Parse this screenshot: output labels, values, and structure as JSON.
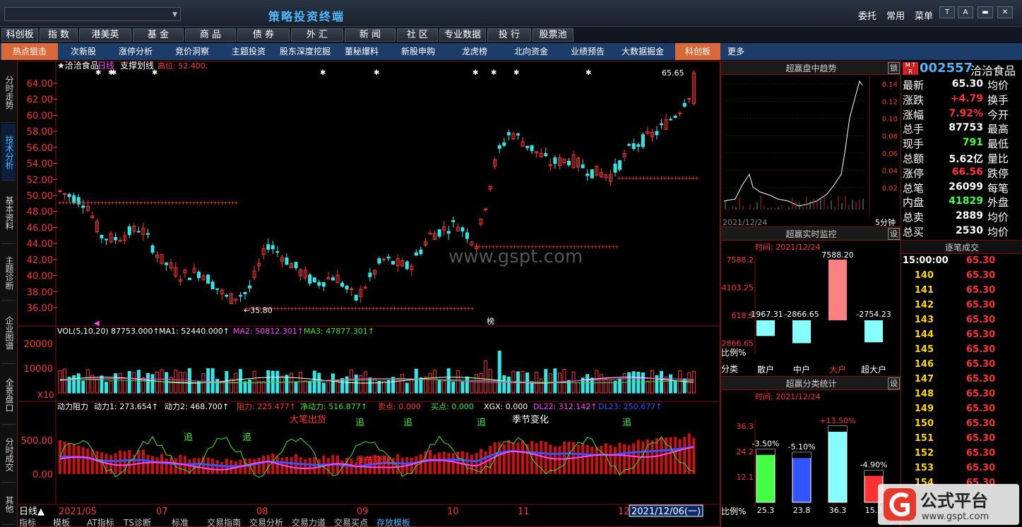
{
  "app": {
    "title": "策略投资终端",
    "menu": [
      "委托",
      "常用",
      "菜单"
    ],
    "window_buttons": [
      "T",
      "A",
      "▬",
      "✕"
    ]
  },
  "nav1": [
    "科创板",
    "指 数",
    "港美英",
    "基 金",
    "商 品",
    "债 券",
    "外 汇",
    "新 闻",
    "社 区",
    "专业数据",
    "投 行",
    "股票池"
  ],
  "nav2": [
    "热点狙击",
    "次新股",
    "涨停分析",
    "竞价洞察",
    "主题投资",
    "股东深度挖掘",
    "董秘爆料",
    "新股申购",
    "龙虎榜",
    "北向资金",
    "业绩预告",
    "大数据掘金",
    "科创板",
    "更多"
  ],
  "left_tabs": [
    "分时走势",
    "技术分析",
    "基本资料",
    "主题诊断",
    "企业图谱",
    "全景盘口",
    "分时成交",
    "其他"
  ],
  "main_chart": {
    "header": "★洽洽食品",
    "period": "日线",
    "indicator": "支撑划线",
    "high_label": "高位: 52.400,",
    "y_ticks": [
      "64.00",
      "62.00",
      "60.00",
      "58.00",
      "56.00",
      "54.00",
      "52.00",
      "50.00",
      "48.00",
      "46.00",
      "44.00",
      "42.00",
      "40.00",
      "38.00",
      "36.00"
    ],
    "low_marker": "←35.80",
    "high_marker": "65.65",
    "bang": "榜"
  },
  "vol_chart": {
    "label": "VOL(5,10,20)",
    "vol": "87753.000↑",
    "ma1": "MA1: 52440.000↑",
    "ma2": "MA2: 50812.301↑",
    "ma3": "MA3: 47877.301↑",
    "y_ticks": [
      "20000",
      "10000"
    ],
    "unit": "X10"
  },
  "power_chart": {
    "label": "动力阻力",
    "p1": "动力1: 273.654↑",
    "p2": "动力2: 468.700↑",
    "zl": "阻力: 225.477↑",
    "jdl": "净动力: 516.877↑",
    "sell": "卖点: 0.000",
    "buy": "买点: 0.000",
    "xgx": "XGX: 0.000",
    "dl22": "DL22: 312.142↑",
    "dl23": "DL23: 250.677↑",
    "y_ticks": [
      "500.00",
      "0.00"
    ],
    "annotations": [
      "大笔出货",
      "追",
      "追",
      "追",
      "追",
      "追",
      "追",
      "季节变化",
      "季节变化"
    ]
  },
  "date_axis": {
    "period": "日线",
    "labels": [
      "2021/05",
      "07",
      "08",
      "09",
      "10",
      "11",
      "12"
    ],
    "cursor": "2021/12/06(一)"
  },
  "bottom_tabs": [
    "指标",
    "模板",
    "AT指标",
    "TS诊断",
    "标准",
    "交易指南",
    "交易分析",
    "交易力道",
    "交易买点",
    "存放模板"
  ],
  "watermark": "www.gspt.com",
  "intraday": {
    "title": "超赢盘中趋势",
    "lock": "锁",
    "date": "2021/12/24",
    "period": "5分钟",
    "y_ticks": [
      "0.14",
      "0.12",
      "0.10",
      "0.08",
      "0.06",
      "0.04",
      "0.02"
    ]
  },
  "monitor": {
    "title": "超赢实时监控",
    "btn": "设",
    "time": "时间: 2021/12/24",
    "y_ticks": [
      "7588.2",
      "4103.25",
      "618.3",
      "-2866.65"
    ],
    "bars": [
      {
        "cat": "散户",
        "value": -1967.31
      },
      {
        "cat": "中户",
        "value": -2866.65
      },
      {
        "cat": "大户",
        "value": 7588.2
      },
      {
        "cat": "超大户",
        "value": -2754.23
      }
    ],
    "ratio_label": "比例%",
    "cat_label": "分类"
  },
  "stats": {
    "title": "超赢分类统计",
    "btn": "设",
    "time": "时间: 2021/12/24",
    "y_ticks": [
      "36.3",
      "24.2",
      "12.1"
    ],
    "bars": [
      {
        "cat": "散户",
        "pct": "-3.50%",
        "value": 25.3
      },
      {
        "cat": "中户",
        "pct": "-5.10%",
        "value": 23.8
      },
      {
        "cat": "大户",
        "pct": "+13.50%",
        "value": 36.3
      },
      {
        "cat": "超大户",
        "pct": "-4.90%",
        "value": 15.3
      }
    ],
    "ratio_label": "比例%",
    "cat_label": "分类"
  },
  "quote": {
    "code": "002557",
    "name": "洽洽食品",
    "rows": [
      [
        "最新",
        "65.30",
        "均价",
        ""
      ],
      [
        "涨跌",
        "+4.79",
        "换手",
        ""
      ],
      [
        "涨幅",
        "7.92%",
        "今开",
        ""
      ],
      [
        "总手",
        "87753",
        "最高",
        ""
      ],
      [
        "现手",
        "791",
        "最低",
        ""
      ],
      [
        "总额",
        "5.62亿",
        "量比",
        ""
      ],
      [
        "涨停",
        "66.56",
        "跌停",
        ""
      ],
      [
        "总笔",
        "26099",
        "每笔",
        ""
      ],
      [
        "内盘",
        "41829",
        "外盘",
        ""
      ],
      [
        "总卖",
        "2889",
        "均价",
        ""
      ],
      [
        "总买",
        "2530",
        "均价",
        ""
      ]
    ]
  },
  "ticks": {
    "title": "逐笔成交",
    "rows": [
      [
        "15:00:00",
        "65.30"
      ],
      [
        "140",
        "65.30"
      ],
      [
        "141",
        "65.30"
      ],
      [
        "142",
        "65.30"
      ],
      [
        "143",
        "65.30"
      ],
      [
        "144",
        "65.30"
      ],
      [
        "145",
        "65.30"
      ],
      [
        "146",
        "65.30"
      ],
      [
        "147",
        "65.30"
      ],
      [
        "148",
        "65.30"
      ],
      [
        "149",
        "65.30"
      ],
      [
        "150",
        "65.30"
      ],
      [
        "151",
        "65.30"
      ],
      [
        "152",
        "65.30"
      ],
      [
        "153",
        "65.30"
      ],
      [
        "154",
        "65.30"
      ]
    ]
  },
  "logo": {
    "text": "公式平台",
    "url": "www.gspt.com"
  },
  "colors": {
    "up": "#ff3333",
    "down": "#33e6e6",
    "axis": "#ff3333",
    "accent": "#4fb7ff"
  }
}
